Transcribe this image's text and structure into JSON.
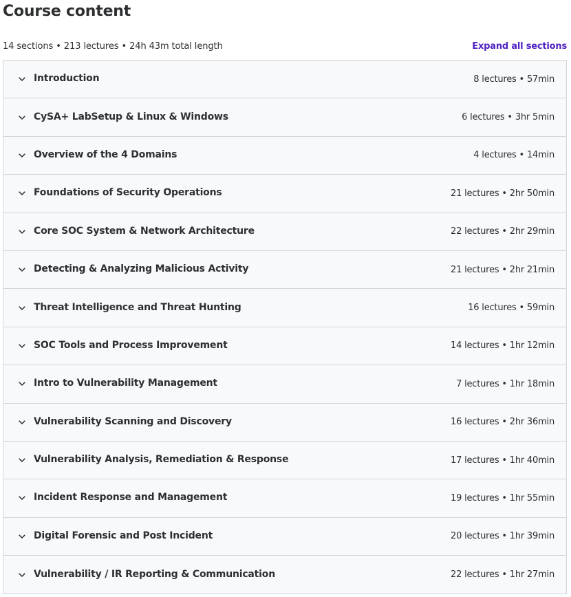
{
  "header": {
    "title": "Course content",
    "summary": "14 sections • 213 lectures • 24h 43m total length",
    "expand_all_label": "Expand all sections"
  },
  "colors": {
    "accent": "#5022c3",
    "section_bg": "#f7f9fa",
    "border": "#d1d7dc",
    "text": "#2d2f31"
  },
  "sections": [
    {
      "title": "Introduction",
      "meta": "8 lectures • 57min"
    },
    {
      "title": "CySA+ LabSetup & Linux & Windows",
      "meta": "6 lectures • 3hr 5min"
    },
    {
      "title": "Overview of the 4 Domains",
      "meta": "4 lectures • 14min"
    },
    {
      "title": "Foundations of Security Operations",
      "meta": "21 lectures • 2hr 50min"
    },
    {
      "title": "Core SOC System & Network Architecture",
      "meta": "22 lectures • 2hr 29min"
    },
    {
      "title": "Detecting & Analyzing Malicious Activity",
      "meta": "21 lectures • 2hr 21min"
    },
    {
      "title": "Threat Intelligence and Threat Hunting",
      "meta": "16 lectures • 59min"
    },
    {
      "title": "SOC Tools and Process Improvement",
      "meta": "14 lectures • 1hr 12min"
    },
    {
      "title": "Intro to Vulnerability Management",
      "meta": "7 lectures • 1hr 18min"
    },
    {
      "title": "Vulnerability Scanning and Discovery",
      "meta": "16 lectures • 2hr 36min"
    },
    {
      "title": "Vulnerability Analysis, Remediation & Response",
      "meta": "17 lectures • 1hr 40min"
    },
    {
      "title": "Incident Response and Management",
      "meta": "19 lectures • 1hr 55min"
    },
    {
      "title": "Digital Forensic and Post Incident",
      "meta": "20 lectures • 1hr 39min"
    },
    {
      "title": "Vulnerability / IR Reporting & Communication",
      "meta": "22 lectures • 1hr 27min"
    }
  ]
}
